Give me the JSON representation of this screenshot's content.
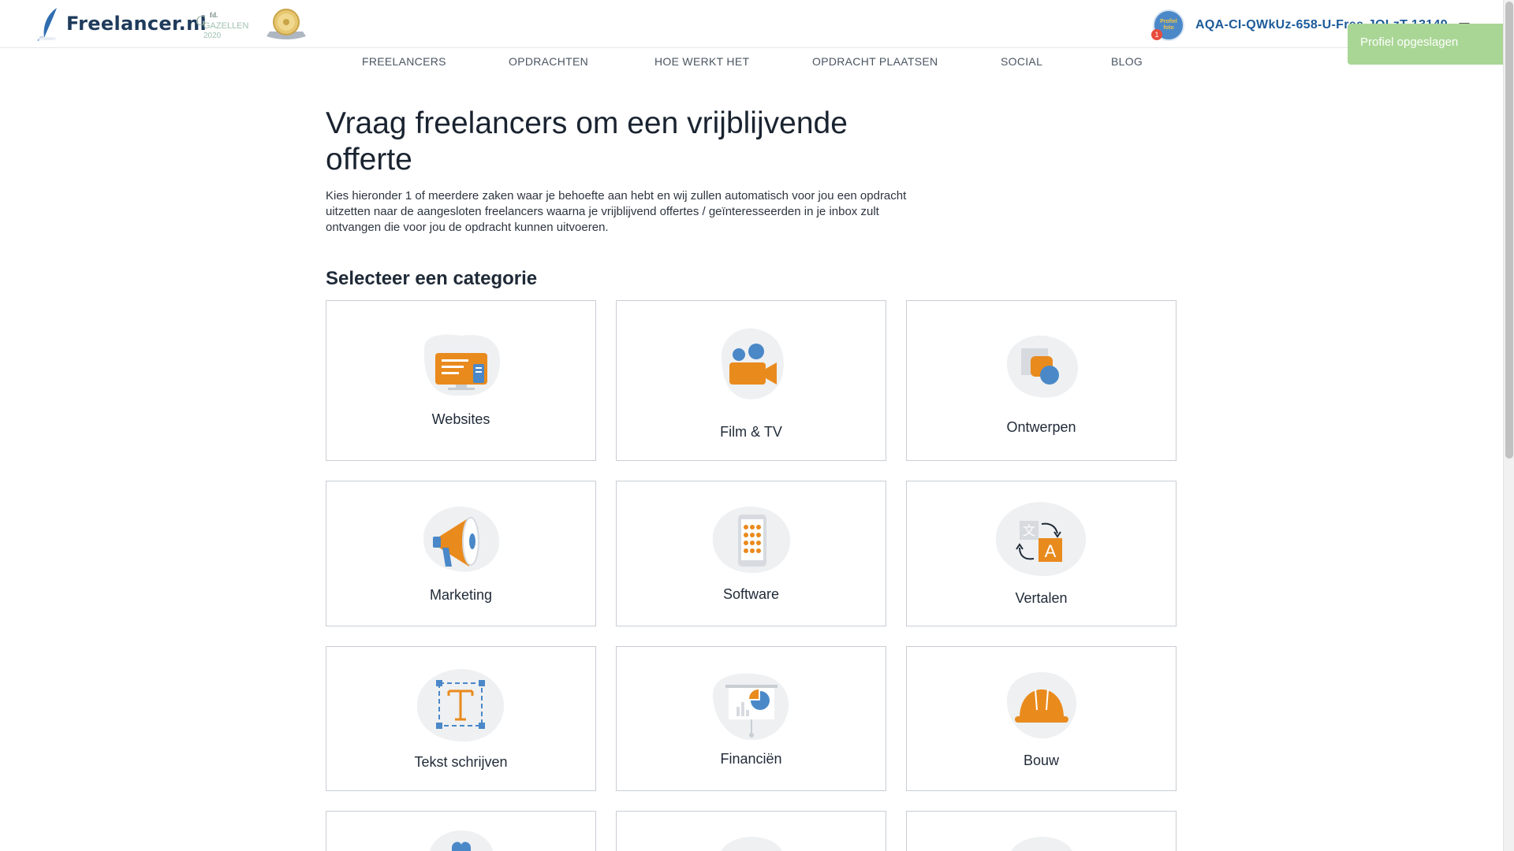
{
  "header": {
    "logo_text": "Freelancer.nl",
    "badge_gazellen_top": "fd.",
    "badge_gazellen_main": "GAZELLEN",
    "badge_gazellen_year": "2020",
    "avatar_text": "Profiel foto",
    "notification_count": "1",
    "username": "AQA-CI-QWkUz-658-U-Free-JOLzT 13149"
  },
  "nav": {
    "items": [
      {
        "label": "FREELANCERS"
      },
      {
        "label": "OPDRACHTEN"
      },
      {
        "label": "HOE WERKT HET"
      },
      {
        "label": "OPDRACHT PLAATSEN"
      },
      {
        "label": "SOCIAL"
      },
      {
        "label": "BLOG"
      }
    ]
  },
  "toast": {
    "message": "Profiel opgeslagen"
  },
  "main": {
    "title": "Vraag freelancers om een vrijblijvende offerte",
    "intro": "Kies hieronder 1 of meerdere zaken waar je behoefte aan hebt en wij zullen automatisch voor jou een opdracht uitzetten naar de aangesloten freelancers waarna je vrijblijvend offertes / geïnteresseerden in je inbox zult ontvangen die voor jou de opdracht kunnen uitvoeren.",
    "section_title": "Selecteer een categorie",
    "categories": [
      {
        "label": "Websites",
        "icon": "monitor-icon"
      },
      {
        "label": "Film & TV",
        "icon": "video-camera-icon"
      },
      {
        "label": "Ontwerpen",
        "icon": "shapes-icon"
      },
      {
        "label": "Marketing",
        "icon": "megaphone-icon"
      },
      {
        "label": "Software",
        "icon": "phone-grid-icon"
      },
      {
        "label": "Vertalen",
        "icon": "translate-icon"
      },
      {
        "label": "Tekst schrijven",
        "icon": "text-tool-icon"
      },
      {
        "label": "Financiën",
        "icon": "presentation-chart-icon"
      },
      {
        "label": "Bouw",
        "icon": "hard-hat-icon"
      },
      {
        "label": "",
        "icon": "heart-icon"
      },
      {
        "label": "",
        "icon": "category-icon"
      },
      {
        "label": "",
        "icon": "category-icon"
      }
    ]
  },
  "colors": {
    "accent_orange": "#e98a1d",
    "accent_blue": "#4a88c8",
    "icon_bg": "#eef0f2",
    "toast_green": "#a9d695",
    "brand_navy": "#1f3b5c"
  }
}
